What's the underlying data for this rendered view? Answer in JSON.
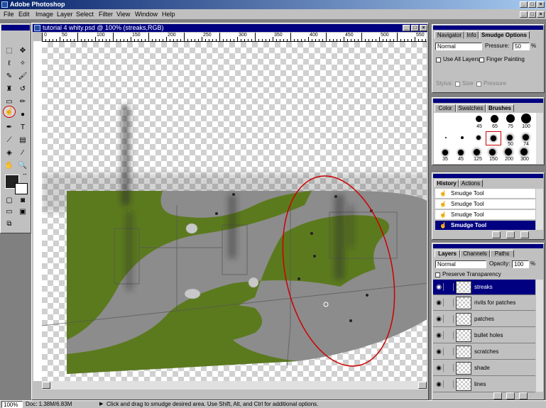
{
  "app": {
    "title": "Adobe Photoshop"
  },
  "menu": [
    "File",
    "Edit",
    "Image",
    "Layer",
    "Select",
    "Filter",
    "View",
    "Window",
    "Help"
  ],
  "document": {
    "title": "tutorial 4 whity.psd @ 100% (streaks,RGB)",
    "ruler_labels": [
      "0",
      "50",
      "100",
      "150",
      "200",
      "250",
      "300",
      "350",
      "400",
      "450",
      "500",
      "550"
    ]
  },
  "status": {
    "zoom": "100%",
    "doc_size": "Doc: 1.38M/6.83M",
    "hint": "Click and drag to smudge desired area. Use Shift, Alt, and Ctrl for additional options."
  },
  "options_palette": {
    "tabs": [
      "Navigator",
      "Info",
      "Smudge Options"
    ],
    "active_tab": "Smudge Options",
    "mode": "Normal",
    "pressure_label": "Pressure:",
    "pressure_value": "50",
    "pressure_unit": "%",
    "use_all_layers": "Use All Layers",
    "finger_painting": "Finger Painting",
    "stylus_label": "Stylus:",
    "stylus_size": "Size",
    "stylus_pressure": "Pressure"
  },
  "brushes_palette": {
    "tabs": [
      "Color",
      "Swatches",
      "Brushes"
    ],
    "active_tab": "Brushes",
    "size_labels": [
      "35",
      "45",
      "65",
      "100",
      "45",
      "65",
      "100",
      "45",
      "65",
      "100",
      "45",
      "65",
      "125",
      "150",
      "200",
      "300"
    ],
    "labels_visible": [
      "45",
      "65",
      "75",
      "100",
      "50",
      "74",
      "35",
      "45",
      "125",
      "150",
      "200",
      "300"
    ]
  },
  "history_palette": {
    "tabs": [
      "History",
      "Actions"
    ],
    "active_tab": "History",
    "items": [
      "Smudge Tool",
      "Smudge Tool",
      "Smudge Tool",
      "Smudge Tool"
    ],
    "selected_index": 3
  },
  "layers_palette": {
    "tabs": [
      "Layers",
      "Channels",
      "Paths"
    ],
    "active_tab": "Layers",
    "blend_mode": "Normal",
    "opacity_label": "Opacity:",
    "opacity_value": "100",
    "opacity_unit": "%",
    "preserve_transparency": "Preserve Transparency",
    "layers": [
      "streaks",
      "rivits for patches",
      "patches",
      "bullet holes",
      "scratches",
      "shade",
      "lines"
    ],
    "selected_layer": "streaks"
  },
  "colors": {
    "title_bar": "#000080",
    "camo_green": "#5b7a1e",
    "camo_grey": "#8a8a8a",
    "highlight_circle": "#cc0000"
  }
}
